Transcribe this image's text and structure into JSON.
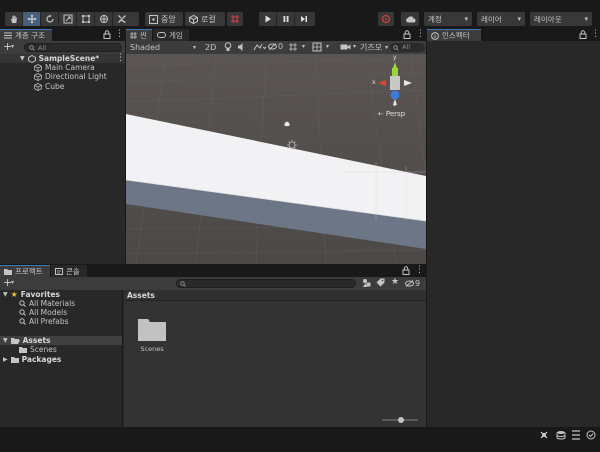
{
  "toolbar": {
    "center_label": "중앙",
    "local_label": "로컬",
    "account_label": "계정",
    "layers_label": "레이어",
    "layout_label": "레이아웃"
  },
  "hierarchy": {
    "tab_label": "계층 구조",
    "search_placeholder": "All",
    "scene_name": "SampleScene*",
    "objects": [
      "Main Camera",
      "Directional Light",
      "Cube"
    ]
  },
  "scene_view": {
    "tab_scene": "씬",
    "tab_game": "게임",
    "shading_mode": "Shaded",
    "mode_2d": "2D",
    "hidden_count": "0",
    "gizmos_label": "기즈모",
    "gizmo_all": "All",
    "persp_label": "Persp",
    "gizmo_axes": {
      "x": "x",
      "y": "y",
      "z": "z"
    }
  },
  "inspector": {
    "tab_label": "인스펙터"
  },
  "project": {
    "tab_project": "프로젝트",
    "tab_console": "콘솔",
    "hidden_packages": "9",
    "favorites_label": "Favorites",
    "favorites": [
      "All Materials",
      "All Models",
      "All Prefabs"
    ],
    "assets_label": "Assets",
    "asset_folders": [
      "Scenes"
    ],
    "packages_label": "Packages",
    "breadcrumb": "Assets",
    "grid_items": [
      {
        "name": "Scenes",
        "icon": "folder-icon"
      }
    ]
  },
  "colors": {
    "selection": "#2c5d87",
    "tab_accent": "#3a79bb",
    "favorite_star": "#f4c430",
    "axis_x": "#e8422f",
    "axis_y": "#9cd43c",
    "axis_z": "#3a7bdc"
  }
}
